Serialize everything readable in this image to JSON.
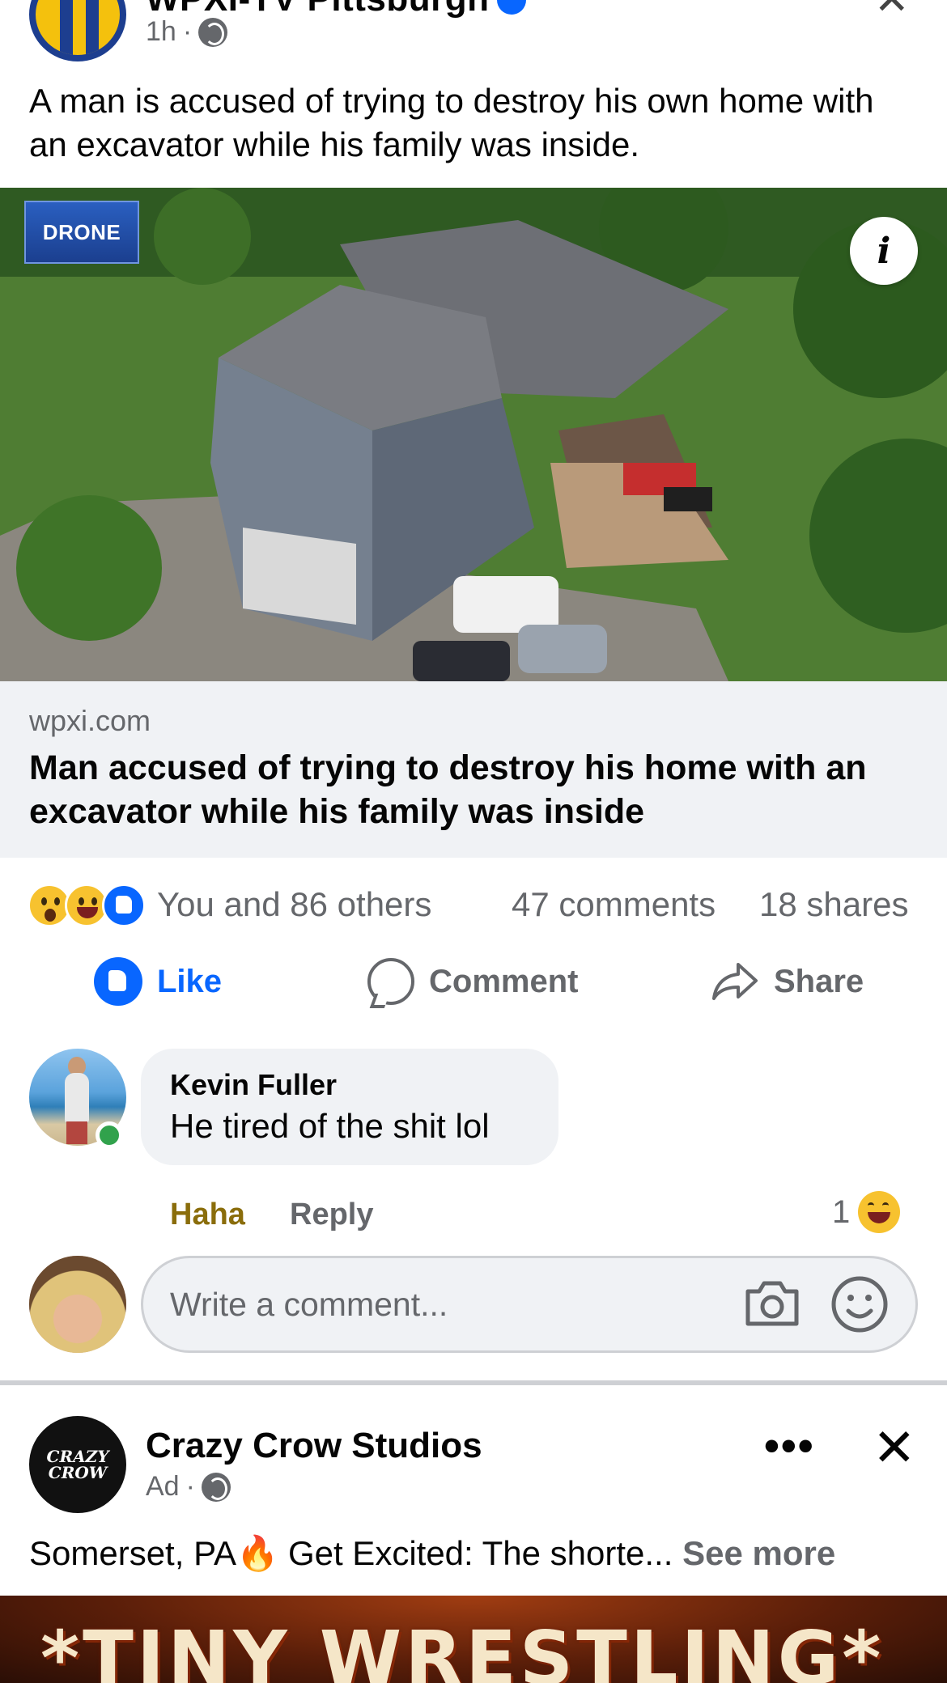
{
  "post": {
    "page_name": "WPXI-TV Pittsburgh",
    "time": "1h",
    "separator": "·",
    "text": "A man is accused of trying to destroy his own home with an excavator while his family was inside.",
    "image": {
      "badge": "DRONE"
    },
    "link": {
      "domain": "wpxi.com",
      "title": "Man accused of trying to destroy his home with an excavator while his family was inside"
    },
    "stats": {
      "reactions_text": "You and 86 others",
      "comments": "47 comments",
      "shares": "18 shares"
    },
    "actions": {
      "like": "Like",
      "comment": "Comment",
      "share": "Share"
    },
    "top_comment": {
      "author": "Kevin Fuller",
      "text": "He tired of the shit lol",
      "reaction_label": "Haha",
      "reply_label": "Reply",
      "reaction_count": "1"
    },
    "write_comment": {
      "placeholder": "Write a comment..."
    }
  },
  "ad_post": {
    "page_name": "Crazy Crow Studios",
    "label": "Ad",
    "separator": "·",
    "logo_line1": "CRAZY",
    "logo_line2": "CROW",
    "text": "Somerset, PA🔥 Get Excited: The shorte...",
    "see_more": "See more",
    "banner": "*TINY WRESTLING*"
  },
  "colors": {
    "accent": "#0866ff",
    "muted": "#65676b",
    "haha": "#8a6d0b"
  }
}
